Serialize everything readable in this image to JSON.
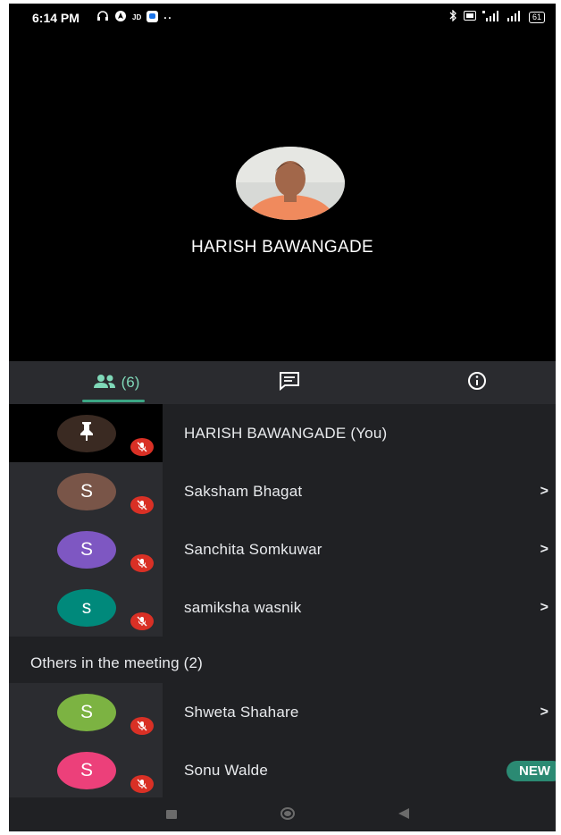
{
  "status_bar": {
    "time": "6:14 PM",
    "left_icons": [
      "headphones-icon",
      "navigation-icon",
      "jd-app-icon",
      "chat-app-icon",
      "more-dots-icon"
    ],
    "right_icons": [
      "bluetooth-icon",
      "volte-icon",
      "signal-4g-icon",
      "signal-icon"
    ],
    "battery": "61"
  },
  "presenter": {
    "name": "HARISH BAWANGADE"
  },
  "tabs": {
    "people_count": "(6)",
    "active": "people"
  },
  "participants": [
    {
      "name": "HARISH BAWANGADE (You)",
      "initial": "",
      "avatar_color": "#3a2a22",
      "muted": true,
      "chevron": false,
      "is_self": true
    },
    {
      "name": "Saksham Bhagat",
      "initial": "S",
      "avatar_color": "#795548",
      "muted": true,
      "chevron": true
    },
    {
      "name": "Sanchita Somkuwar",
      "initial": "S",
      "avatar_color": "#7e57c2",
      "muted": true,
      "chevron": true
    },
    {
      "name": "samiksha wasnik",
      "initial": "s",
      "avatar_color": "#00897b",
      "muted": true,
      "chevron": true
    }
  ],
  "others_section": {
    "title": "Others in the meeting (2)",
    "participants": [
      {
        "name": "Shweta Shahare",
        "initial": "S",
        "avatar_color": "#7cb342",
        "muted": true,
        "chevron": true
      },
      {
        "name": "Sonu Walde",
        "initial": "S",
        "avatar_color": "#ec407a",
        "muted": true,
        "badge": "NEW"
      }
    ]
  },
  "colors": {
    "accent": "#7fd8b8",
    "mute_red": "#d93025",
    "list_bg": "#202124",
    "new_badge": "#2b8a73"
  }
}
